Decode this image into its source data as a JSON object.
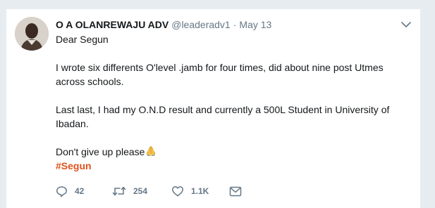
{
  "tweet": {
    "author_name": "O A OLANREWAJU ADV",
    "handle": "@leaderadv1",
    "separator": "·",
    "timestamp": "May 13",
    "text": {
      "greeting": "Dear Segun",
      "paragraph1": "I wrote six differents O'level .jamb for four times, did about nine post Utmes across schools.",
      "paragraph2": "Last last, I had my O.N.D result and currently a 500L Student in University of Ibadan.",
      "closing": "Don't give up please",
      "hashtag": "#Segun"
    },
    "emoji": "folded-hands-icon",
    "hashtag_color": "#e0531b",
    "actions": {
      "replies": "42",
      "retweets": "254",
      "likes": "1.1K"
    }
  },
  "icons": {
    "more": "chevron-down-icon",
    "reply": "reply-icon",
    "retweet": "retweet-icon",
    "like": "heart-icon",
    "message": "envelope-icon"
  }
}
